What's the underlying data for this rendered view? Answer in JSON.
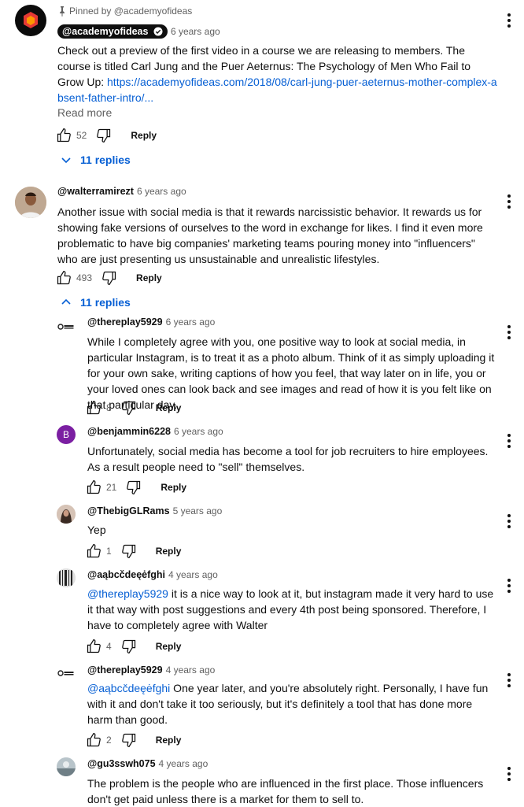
{
  "pinned": {
    "label": "Pinned by @academyofideas",
    "handle": "@academyofideas",
    "time": "6 years ago",
    "text": "Check out a preview of the first video in a course we are releasing to members. The course is titled Carl Jung and the Puer Aeternus: The Psychology of Men Who Fail to Grow Up:",
    "link": "https://academyofideas.com/2018/08/carl-jung-puer-aeternus-mother-complex-absent-father-intro/...",
    "read_more": "Read more",
    "likes": "52",
    "reply": "Reply",
    "replies_toggle": "11 replies"
  },
  "comment2": {
    "handle": "@walterramirezt",
    "time": "6 years ago",
    "text": "Another issue with social media is that it rewards narcissistic behavior. It rewards us for showing fake versions of ourselves to the word in exchange for likes. I find it even more problematic to have big companies' marketing teams pouring money into \"influencers\" who are just presenting us unsustainable and unrealistic lifestyles.",
    "likes": "493",
    "reply": "Reply",
    "replies_toggle": "11 replies"
  },
  "replies": [
    {
      "handle": "@thereplay5929",
      "time": "6 years ago",
      "mention": "",
      "text": "While I completely agree with you, one positive way to look at social media, in particular Instagram, is to treat it as a photo album. Think of it as simply uploading it for your own sake, writing captions of how you feel, that way later on in life, you or your loved ones can look back and see images and read of how it is you felt like on that particular day.",
      "likes": "8",
      "reply": "Reply"
    },
    {
      "handle": "@benjammin6228",
      "time": "6 years ago",
      "mention": "",
      "text": "Unfortunately, social media has become a tool for job recruiters to hire employees. As a result people need to \"sell\" themselves.",
      "likes": "21",
      "reply": "Reply",
      "avatar_letter": "B",
      "avatar_color": "#7b1fa2"
    },
    {
      "handle": "@ThebigGLRams",
      "time": "5 years ago",
      "mention": "",
      "text": "Yep",
      "likes": "1",
      "reply": "Reply"
    },
    {
      "handle": "@aąbcčdeęėfghi",
      "time": "4 years ago",
      "mention": "@thereplay5929",
      "text": " it is a nice way to look at it, but instagram made it very hard to use it that way with post suggestions and every 4th post being sponsored. Therefore, I have to completely agree with Walter",
      "likes": "4",
      "reply": "Reply"
    },
    {
      "handle": "@thereplay5929",
      "time": "4 years ago",
      "mention": "@aąbcčdeęėfghi",
      "text": " One year later, and you're absolutely right. Personally, I have fun with it and don't take it too seriously, but it's definitely a tool that has done more harm than good.",
      "likes": "2",
      "reply": "Reply"
    },
    {
      "handle": "@gu3sswh075",
      "time": "4 years ago",
      "mention": "",
      "text": "The problem is the people who are influenced in the first place. Those influencers don't get paid unless there is a market for them to sell to.",
      "likes": "",
      "reply": ""
    }
  ],
  "colors": {
    "link": "#065fd4",
    "text": "#0f0f0f",
    "muted": "#606060",
    "academy_logo": "#e53935"
  }
}
